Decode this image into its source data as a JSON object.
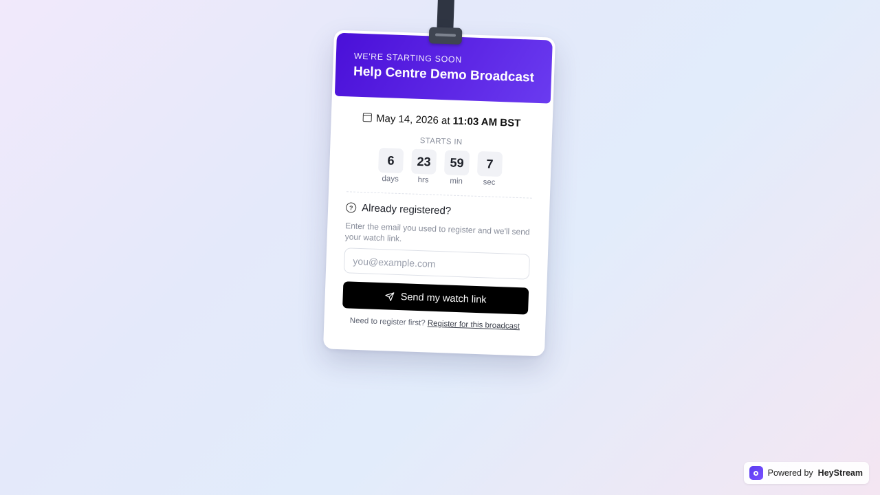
{
  "header": {
    "eyebrow": "WE'RE STARTING SOON",
    "title": "Help Centre Demo Broadcast"
  },
  "schedule": {
    "icon": "calendar-icon",
    "date": "May 14, 2026",
    "connector": "at",
    "time": "11:03 AM BST"
  },
  "countdown": {
    "label": "STARTS IN",
    "units": [
      {
        "value": "6",
        "label": "days"
      },
      {
        "value": "23",
        "label": "hrs"
      },
      {
        "value": "59",
        "label": "min"
      },
      {
        "value": "7",
        "label": "sec"
      }
    ]
  },
  "registered": {
    "icon": "question-icon",
    "heading": "Already registered?",
    "description": "Enter the email you used to register and we'll send your watch link.",
    "email_placeholder": "you@example.com",
    "email_value": "",
    "button_icon": "send-icon",
    "button_label": "Send my watch link"
  },
  "footer": {
    "prompt": "Need to register first?",
    "link_label": "Register for this broadcast"
  },
  "powered": {
    "prefix": "Powered by",
    "brand": "HeyStream",
    "icon": "heystream-logo-icon"
  },
  "colors": {
    "header_gradient_start": "#4a10d8",
    "header_gradient_end": "#6a3bf0",
    "button_bg": "#000000",
    "brand": "#5a3bf0"
  }
}
